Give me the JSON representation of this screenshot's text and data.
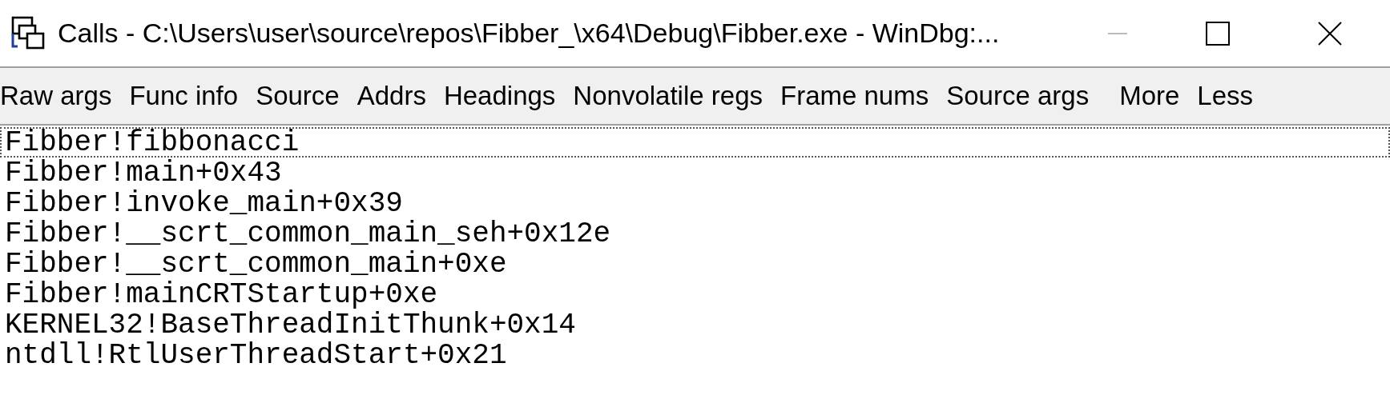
{
  "window": {
    "title": "Calls - C:\\Users\\user\\source\\repos\\Fibber_\\x64\\Debug\\Fibber.exe - WinDbg:..."
  },
  "toolbar": [
    {
      "label": "Raw args"
    },
    {
      "label": "Func info"
    },
    {
      "label": "Source"
    },
    {
      "label": "Addrs"
    },
    {
      "label": "Headings"
    },
    {
      "label": "Nonvolatile regs"
    },
    {
      "label": "Frame nums"
    },
    {
      "label": "Source args"
    },
    {
      "label": "More"
    },
    {
      "label": "Less"
    }
  ],
  "frames": [
    {
      "text": "Fibber!fibbonacci",
      "selected": true
    },
    {
      "text": "Fibber!main+0x43",
      "selected": false
    },
    {
      "text": "Fibber!invoke_main+0x39",
      "selected": false
    },
    {
      "text": "Fibber!__scrt_common_main_seh+0x12e",
      "selected": false
    },
    {
      "text": "Fibber!__scrt_common_main+0xe",
      "selected": false
    },
    {
      "text": "Fibber!mainCRTStartup+0xe",
      "selected": false
    },
    {
      "text": "KERNEL32!BaseThreadInitThunk+0x14",
      "selected": false
    },
    {
      "text": "ntdll!RtlUserThreadStart+0x21",
      "selected": false
    }
  ]
}
